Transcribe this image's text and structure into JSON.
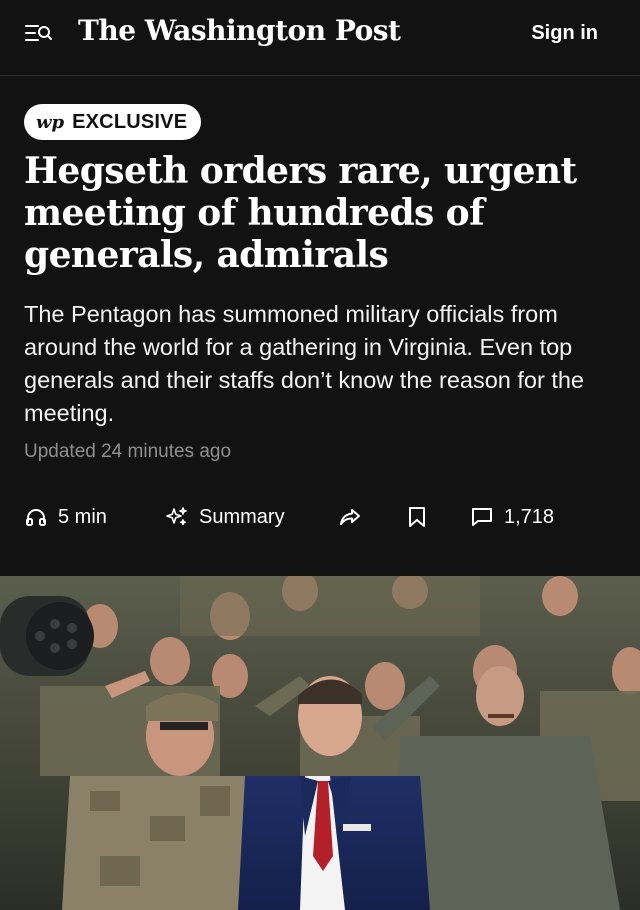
{
  "header": {
    "logo_text": "The Washington Post",
    "signin_label": "Sign in"
  },
  "badge": {
    "logo": "wp",
    "label": "EXCLUSIVE"
  },
  "article": {
    "headline": "Hegseth orders rare, urgent meeting of hundreds of generals, admirals",
    "dek": "The Pentagon has summoned military officials from around the world for a gathering in Virginia. Even top generals and their staffs don’t know the reason for the meeting.",
    "updated": "Updated 24 minutes ago"
  },
  "actions": {
    "listen_label": "5 min",
    "summary_label": "Summary",
    "comments_count": "1,718"
  },
  "icons": {
    "menu": "menu-search-icon",
    "listen": "headphones-icon",
    "summary": "sparkle-icon",
    "share": "share-icon",
    "save": "bookmark-icon",
    "comments": "comment-icon"
  },
  "photo": {
    "description_only_visual": true
  },
  "colors": {
    "background": "#121212",
    "text": "#ffffff",
    "muted": "#8f8f8f",
    "badge_bg": "#ffffff"
  }
}
